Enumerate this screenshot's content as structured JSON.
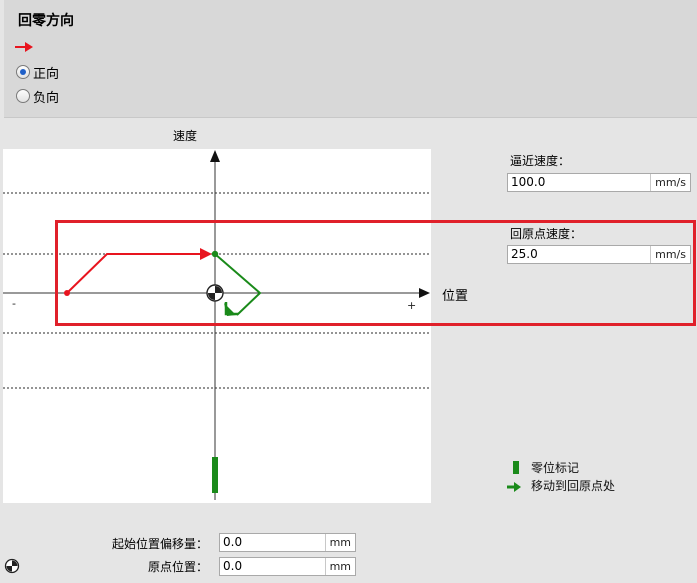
{
  "section": {
    "title": "回零方向",
    "options": [
      {
        "label": "正向",
        "checked": true
      },
      {
        "label": "负向",
        "checked": false
      }
    ]
  },
  "diagram": {
    "y_axis_label": "速度",
    "x_axis_label": "位置",
    "minus_label": "-",
    "plus_label": "+"
  },
  "approach": {
    "label": "逼近速度：",
    "value": "100.0",
    "unit": "mm/s"
  },
  "homing": {
    "label": "回原点速度：",
    "value": "25.0",
    "unit": "mm/s"
  },
  "legend": {
    "zero_mark": "零位标记",
    "move_to_home": "移动到回原点处"
  },
  "offset": {
    "label": "起始位置偏移量：",
    "value": "0.0",
    "unit": "mm"
  },
  "home_pos": {
    "label": "原点位置：",
    "value": "0.0",
    "unit": "mm"
  },
  "colors": {
    "red": "#e8141e",
    "green": "#1a8a1a",
    "highlight": "#e0202a"
  }
}
